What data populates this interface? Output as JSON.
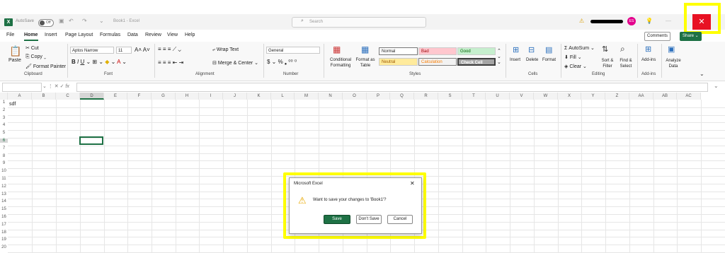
{
  "titlebar": {
    "autosave": "AutoSave",
    "toggle": "Off",
    "doc_title": "Book1 - Excel",
    "search_placeholder": "Search",
    "avatar": "ES",
    "close": "✕"
  },
  "tabs": [
    "File",
    "Home",
    "Insert",
    "Page Layout",
    "Formulas",
    "Data",
    "Review",
    "View",
    "Help"
  ],
  "top_right": {
    "comments": "Comments",
    "share": "Share"
  },
  "ribbon": {
    "clipboard": {
      "paste": "Paste",
      "cut": "Cut",
      "copy": "Copy",
      "format_painter": "Format Painter",
      "label": "Clipboard"
    },
    "font": {
      "name": "Aptos Narrow",
      "size": "11",
      "label": "Font"
    },
    "alignment": {
      "wrap": "Wrap Text",
      "merge": "Merge & Center",
      "label": "Alignment"
    },
    "number": {
      "format": "General",
      "label": "Number"
    },
    "styles": {
      "conditional": "Conditional Formatting",
      "format_table": "Format as Table",
      "normal": "Normal",
      "bad": "Bad",
      "good": "Good",
      "neutral": "Neutral",
      "calculation": "Calculation",
      "check_cell": "Check Cell",
      "label": "Styles"
    },
    "cells": {
      "insert": "Insert",
      "delete": "Delete",
      "format": "Format",
      "label": "Cells"
    },
    "editing": {
      "autosum": "AutoSum",
      "fill": "Fill",
      "clear": "Clear",
      "sort": "Sort & Filter",
      "find": "Find & Select",
      "label": "Editing"
    },
    "addins": {
      "addins": "Add-ins",
      "label": "Add-ins"
    },
    "analyze": {
      "label": "Analyze Data"
    }
  },
  "formula": {
    "fx": "fx"
  },
  "columns": [
    "A",
    "B",
    "C",
    "D",
    "E",
    "F",
    "G",
    "H",
    "I",
    "J",
    "K",
    "L",
    "M",
    "N",
    "O",
    "P",
    "Q",
    "R",
    "S",
    "T",
    "U",
    "V",
    "W",
    "X",
    "Y",
    "Z",
    "AA",
    "AB",
    "AC"
  ],
  "rows": [
    "1",
    "2",
    "3",
    "4",
    "5",
    "6",
    "7",
    "8",
    "9",
    "10",
    "11",
    "12",
    "13",
    "14",
    "15",
    "16",
    "17",
    "18",
    "19",
    "20"
  ],
  "cell_a1": "sdf",
  "dialog": {
    "title": "Microsoft Excel",
    "message": "Want to save your changes to 'Book1'?",
    "save": "Save",
    "dont_save": "Don't Save",
    "cancel": "Cancel",
    "close": "✕"
  },
  "colors": {
    "excel_green": "#1e7145",
    "highlight": "#ffff00",
    "close_red": "#e81123"
  }
}
